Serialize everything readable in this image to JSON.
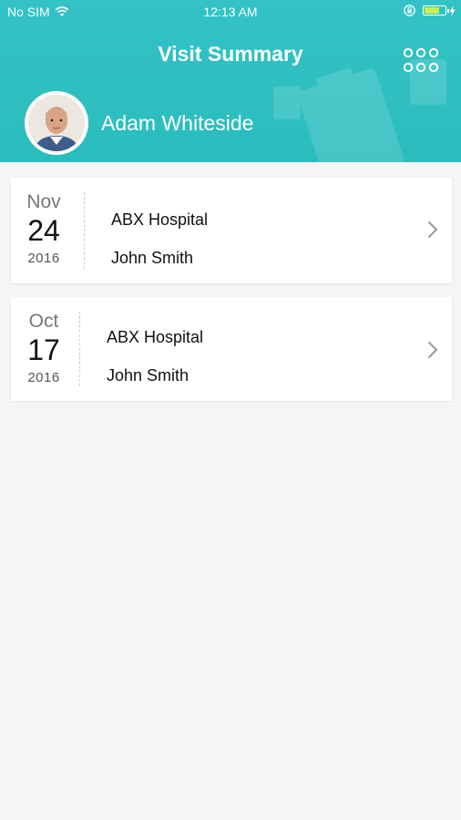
{
  "status_bar": {
    "carrier": "No SIM",
    "time": "12:13 AM",
    "battery_level": 0.75
  },
  "header": {
    "title": "Visit Summary",
    "menu_icon": "grid-dots-icon"
  },
  "profile": {
    "name": "Adam Whiteside"
  },
  "visits": [
    {
      "month": "Nov",
      "day": "24",
      "year": "2016",
      "hospital": "ABX Hospital",
      "doctor": "John Smith"
    },
    {
      "month": "Oct",
      "day": "17",
      "year": "2016",
      "hospital": "ABX Hospital",
      "doctor": "John Smith"
    }
  ],
  "colors": {
    "header": "#2fc0c2",
    "background": "#f5f5f5",
    "card": "#ffffff",
    "battery": "#c6f04d"
  }
}
